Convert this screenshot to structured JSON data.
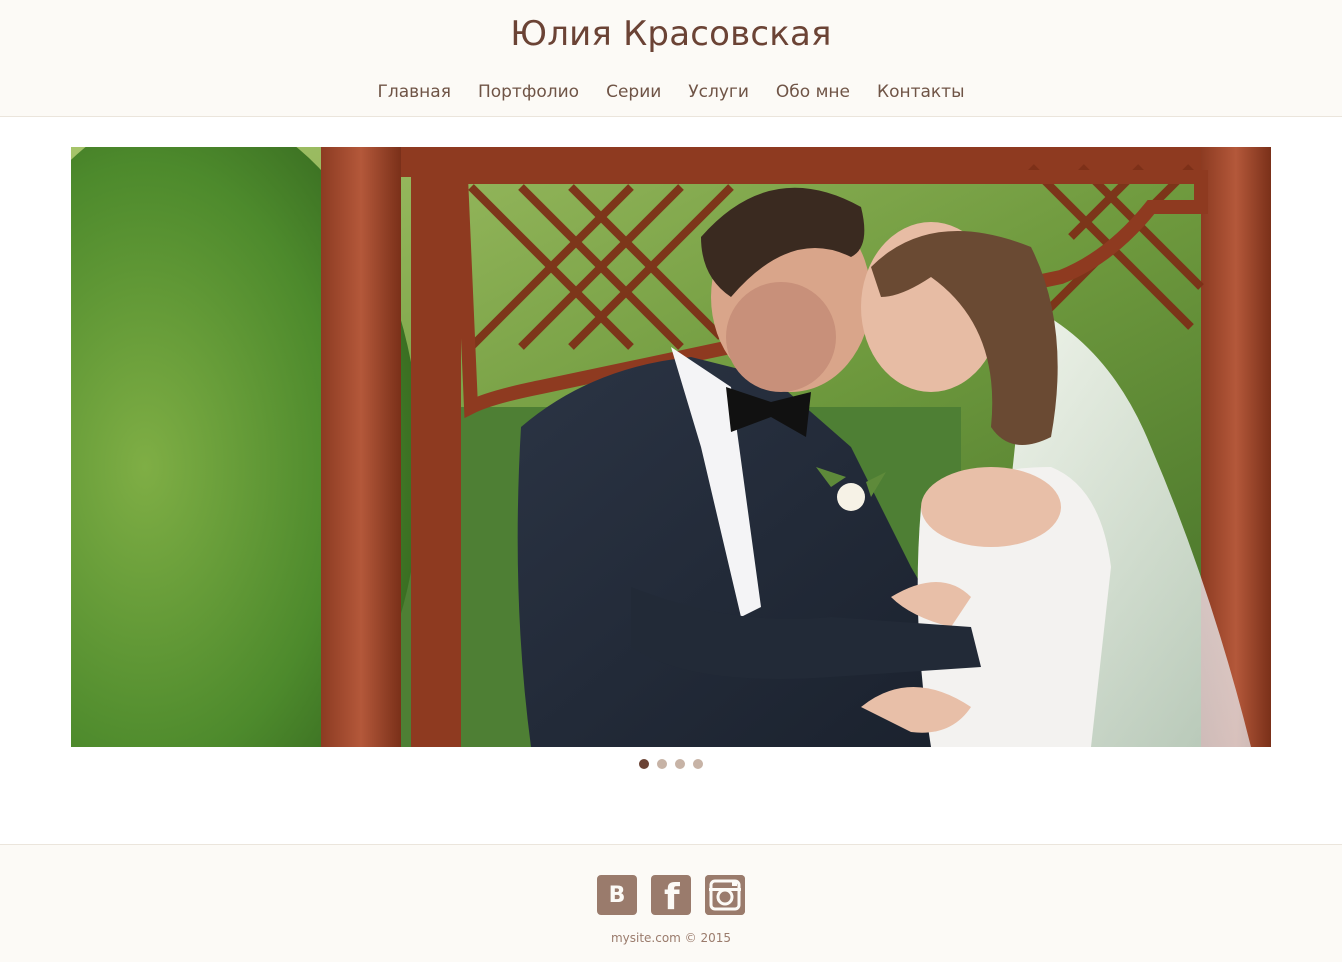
{
  "header": {
    "site_title": "Юлия Красовская"
  },
  "nav": {
    "items": [
      "Главная",
      "Портфолио",
      "Серии",
      "Услуги",
      "Обо мне",
      "Контакты"
    ]
  },
  "slider": {
    "slide_count": 4,
    "active_index": 0
  },
  "footer": {
    "social": [
      {
        "name": "vk-icon",
        "label": "В"
      },
      {
        "name": "facebook-icon",
        "label": "f"
      },
      {
        "name": "instagram-icon",
        "label": ""
      }
    ],
    "copyright": "mysite.com © 2015"
  },
  "colors": {
    "brand": "#6b4335",
    "nav_text": "#6f5446",
    "icon_bg": "#9a7b6c",
    "header_bg": "#fcfaf6"
  }
}
